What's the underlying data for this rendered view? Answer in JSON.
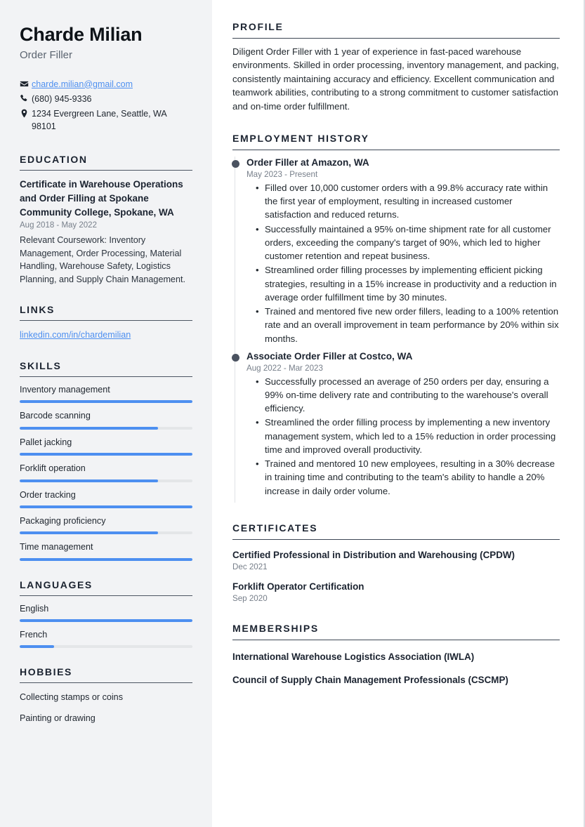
{
  "sidebar": {
    "name": "Charde Milian",
    "job_title": "Order Filler",
    "contact": [
      {
        "icon": "envelope-icon",
        "value": "charde.milian@gmail.com",
        "is_link": true
      },
      {
        "icon": "phone-icon",
        "value": "(680) 945-9336",
        "is_link": false
      },
      {
        "icon": "map-pin-icon",
        "value": "1234 Evergreen Lane, Seattle, WA 98101",
        "is_link": false
      }
    ],
    "education": {
      "heading": "EDUCATION",
      "items": [
        {
          "title": "Certificate in Warehouse Operations and Order Filling at Spokane Community College, Spokane, WA",
          "date": "Aug 2018 - May 2022",
          "description": "Relevant Coursework: Inventory Management, Order Processing, Material Handling, Warehouse Safety, Logistics Planning, and Supply Chain Management."
        }
      ]
    },
    "links": {
      "heading": "LINKS",
      "items": [
        {
          "label": "linkedin.com/in/chardemilian"
        }
      ]
    },
    "skills": {
      "heading": "SKILLS",
      "items": [
        {
          "label": "Inventory management",
          "level": 100
        },
        {
          "label": "Barcode scanning",
          "level": 80
        },
        {
          "label": "Pallet jacking",
          "level": 100
        },
        {
          "label": "Forklift operation",
          "level": 80
        },
        {
          "label": "Order tracking",
          "level": 100
        },
        {
          "label": "Packaging proficiency",
          "level": 80
        },
        {
          "label": "Time management",
          "level": 100
        }
      ]
    },
    "languages": {
      "heading": "LANGUAGES",
      "items": [
        {
          "label": "English",
          "level": 100
        },
        {
          "label": "French",
          "level": 20
        }
      ]
    },
    "hobbies": {
      "heading": "HOBBIES",
      "items": [
        {
          "label": "Collecting stamps or coins"
        },
        {
          "label": "Painting or drawing"
        }
      ]
    }
  },
  "main": {
    "profile": {
      "heading": "PROFILE",
      "text": "Diligent Order Filler with 1 year of experience in fast-paced warehouse environments. Skilled in order processing, inventory management, and packing, consistently maintaining accuracy and efficiency. Excellent communication and teamwork abilities, contributing to a strong commitment to customer satisfaction and on-time order fulfillment."
    },
    "employment": {
      "heading": "EMPLOYMENT HISTORY",
      "jobs": [
        {
          "role": "Order Filler at Amazon, WA",
          "date": "May 2023 - Present",
          "bullets": [
            "Filled over 10,000 customer orders with a 99.8% accuracy rate within the first year of employment, resulting in increased customer satisfaction and reduced returns.",
            "Successfully maintained a 95% on-time shipment rate for all customer orders, exceeding the company's target of 90%, which led to higher customer retention and repeat business.",
            "Streamlined order filling processes by implementing efficient picking strategies, resulting in a 15% increase in productivity and a reduction in average order fulfillment time by 30 minutes.",
            "Trained and mentored five new order fillers, leading to a 100% retention rate and an overall improvement in team performance by 20% within six months."
          ]
        },
        {
          "role": "Associate Order Filler at Costco, WA",
          "date": "Aug 2022 - Mar 2023",
          "bullets": [
            "Successfully processed an average of 250 orders per day, ensuring a 99% on-time delivery rate and contributing to the warehouse's overall efficiency.",
            "Streamlined the order filling process by implementing a new inventory management system, which led to a 15% reduction in order processing time and improved overall productivity.",
            "Trained and mentored 10 new employees, resulting in a 30% decrease in training time and contributing to the team's ability to handle a 20% increase in daily order volume."
          ]
        }
      ]
    },
    "certificates": {
      "heading": "CERTIFICATES",
      "items": [
        {
          "title": "Certified Professional in Distribution and Warehousing (CPDW)",
          "date": "Dec 2021"
        },
        {
          "title": "Forklift Operator Certification",
          "date": "Sep 2020"
        }
      ]
    },
    "memberships": {
      "heading": "MEMBERSHIPS",
      "items": [
        {
          "title": "International Warehouse Logistics Association (IWLA)"
        },
        {
          "title": "Council of Supply Chain Management Professionals (CSCMP)"
        }
      ]
    }
  },
  "colors": {
    "accent": "#4d8ff0",
    "heading": "#1b2330",
    "sidebar_bg": "#f2f3f5",
    "muted": "#777f8a"
  }
}
